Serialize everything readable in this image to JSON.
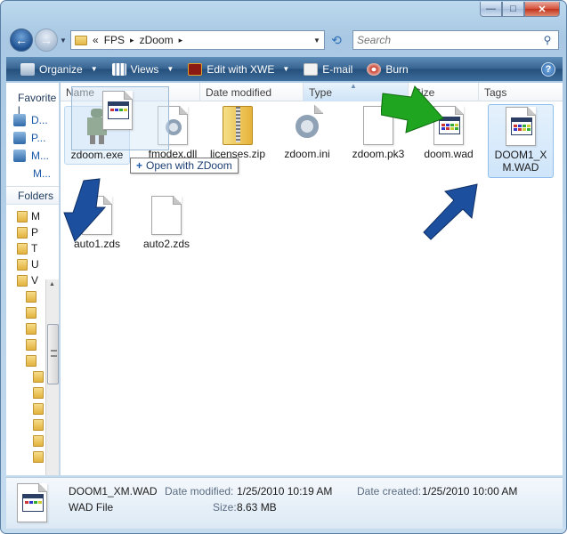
{
  "caption": {
    "minimize": "—",
    "maximize": "□",
    "close": "✕"
  },
  "address": {
    "chevron": "«",
    "crumbs": [
      "FPS",
      "zDoom"
    ],
    "sep": "▸"
  },
  "search": {
    "placeholder": "Search"
  },
  "toolbar": {
    "organize": "Organize",
    "views": "Views",
    "edit_with": "Edit with XWE",
    "email": "E-mail",
    "burn": "Burn",
    "help": "?"
  },
  "navpane": {
    "favorites_head": "Favorite l",
    "links": [
      "D...",
      "P...",
      "M...",
      "M..."
    ],
    "folders_head": "Folders",
    "tree": [
      "M",
      "P",
      "T",
      "U",
      "V"
    ]
  },
  "columns": [
    "Name",
    "Date modified",
    "Type",
    "Size",
    "Tags"
  ],
  "files": [
    {
      "name": "zdoom.exe",
      "kind": "exe"
    },
    {
      "name": "fmodex.dll",
      "kind": "dll"
    },
    {
      "name": "licenses.zip",
      "kind": "zip"
    },
    {
      "name": "zdoom.ini",
      "kind": "ini"
    },
    {
      "name": "zdoom.pk3",
      "kind": "blank"
    },
    {
      "name": "doom.wad",
      "kind": "wad"
    },
    {
      "name": "DOOM1_XM.WAD",
      "kind": "wad"
    },
    {
      "name": "auto1.zds",
      "kind": "blank"
    },
    {
      "name": "auto2.zds",
      "kind": "blank"
    }
  ],
  "drag_tooltip": "Open with ZDoom",
  "details": {
    "name": "DOOM1_XM.WAD",
    "type": "WAD File",
    "date_modified_label": "Date modified:",
    "date_modified": "1/25/2010 10:19 AM",
    "date_created_label": "Date created:",
    "date_created": "1/25/2010 10:00 AM",
    "size_label": "Size:",
    "size": "8.63 MB"
  },
  "colors": {
    "arrow_blue": "#1d4f9f",
    "arrow_green": "#1fa51f",
    "selection": "#cfe5fa",
    "toolbar": "#2f5b89"
  }
}
